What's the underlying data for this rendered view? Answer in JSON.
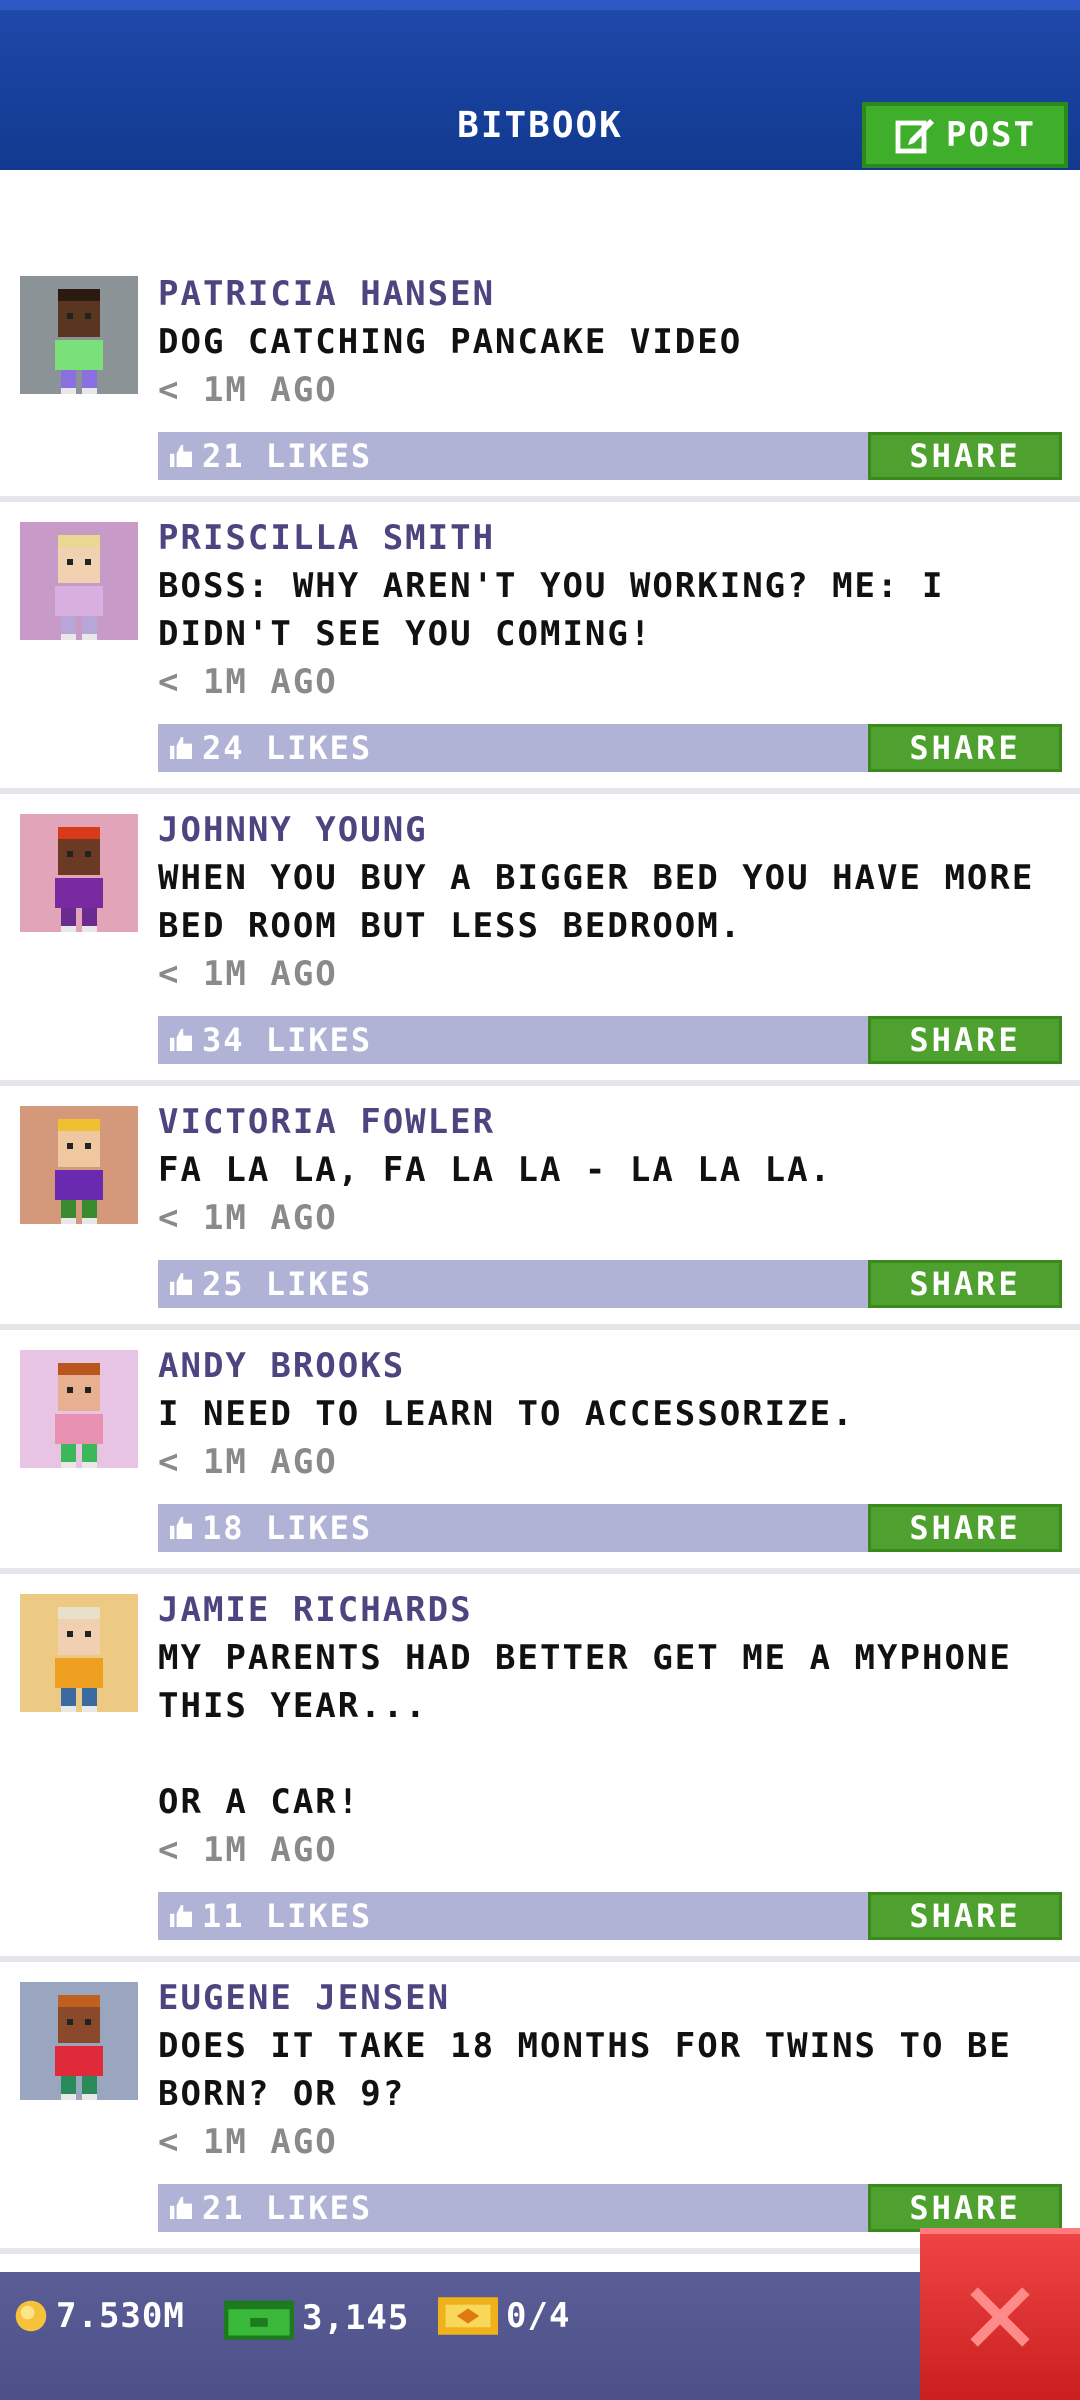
{
  "header": {
    "title": "BITBOOK",
    "post_label": "POST"
  },
  "posts": [
    {
      "name": "PATRICIA HANSEN",
      "text": "DOG CATCHING PANCAKE VIDEO",
      "time": "< 1M AGO",
      "likes": "21 LIKES",
      "share": "SHARE",
      "avatar_bg": "#8c9396",
      "skin": "#5a3520",
      "hair": "#2a1a10",
      "shirt": "#7ae07a",
      "legs": "#8a6fe0"
    },
    {
      "name": "PRISCILLA SMITH",
      "text": "BOSS: WHY AREN'T YOU WORKING? ME: I DIDN'T SEE YOU COMING!",
      "time": "< 1M AGO",
      "likes": "24 LIKES",
      "share": "SHARE",
      "avatar_bg": "#c89ac8",
      "skin": "#f0d2b0",
      "hair": "#e8d890",
      "shirt": "#d8b0e0",
      "legs": "#b8a6d8"
    },
    {
      "name": "JOHNNY YOUNG",
      "text": "WHEN YOU BUY A BIGGER BED YOU HAVE MORE BED ROOM BUT LESS BEDROOM.",
      "time": "< 1M AGO",
      "likes": "34 LIKES",
      "share": "SHARE",
      "avatar_bg": "#e2a4b8",
      "skin": "#6a3a22",
      "hair": "#d83a1a",
      "shirt": "#7a2aa0",
      "legs": "#6a2a90"
    },
    {
      "name": "VICTORIA FOWLER",
      "text": "FA LA LA, FA LA LA - LA LA LA.",
      "time": "< 1M AGO",
      "likes": "25 LIKES",
      "share": "SHARE",
      "avatar_bg": "#d4987a",
      "skin": "#f0c8a0",
      "hair": "#f0c030",
      "shirt": "#6a2ab0",
      "legs": "#3a8a30"
    },
    {
      "name": "ANDY BROOKS",
      "text": "I NEED TO LEARN TO ACCESSORIZE.",
      "time": "< 1M AGO",
      "likes": "18 LIKES",
      "share": "SHARE",
      "avatar_bg": "#e8c4e4",
      "skin": "#e8b090",
      "hair": "#b8561e",
      "shirt": "#e890b0",
      "legs": "#3ab85a"
    },
    {
      "name": "JAMIE RICHARDS",
      "text": "MY PARENTS HAD BETTER GET ME A MYPHONE THIS YEAR...\n\nOR A CAR!",
      "time": "< 1M AGO",
      "likes": "11 LIKES",
      "share": "SHARE",
      "avatar_bg": "#ecca84",
      "skin": "#f0d0b0",
      "hair": "#e8e0c8",
      "shirt": "#f0a020",
      "legs": "#3a6aa0"
    },
    {
      "name": "EUGENE JENSEN",
      "text": "DOES IT TAKE 18 MONTHS FOR TWINS TO BE BORN? OR 9?",
      "time": "< 1M AGO",
      "likes": "21 LIKES",
      "share": "SHARE",
      "avatar_bg": "#9aa6c0",
      "skin": "#8a4a2a",
      "hair": "#c0601e",
      "shirt": "#e02a3a",
      "legs": "#2a8a5a"
    }
  ],
  "bottom_bar": {
    "coins": "7.530M",
    "bux": "3,145",
    "tickets": "0/4"
  },
  "colors": {
    "header": "#163f9a",
    "accent_green": "#3fae2a",
    "likes_bar": "#b0b3d6",
    "name_color": "#4c4580",
    "close_red": "#d82a2a"
  }
}
